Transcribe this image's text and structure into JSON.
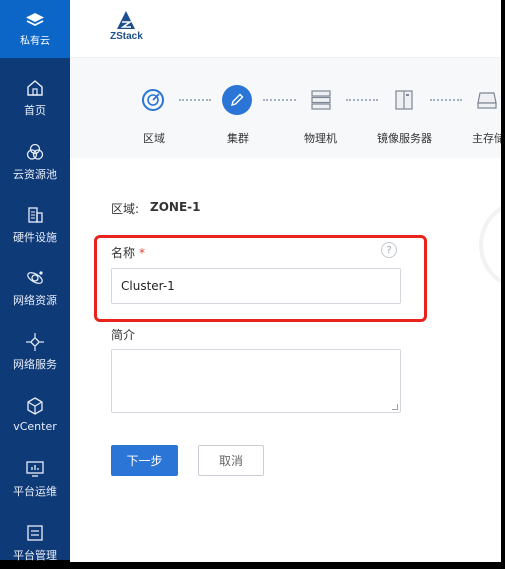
{
  "sidebar": {
    "top": {
      "label": "私有云",
      "icon": "layers-icon"
    },
    "items": [
      {
        "label": "首页",
        "icon": "home-icon"
      },
      {
        "label": "云资源池",
        "icon": "circles-icon"
      },
      {
        "label": "硬件设施",
        "icon": "building-icon"
      },
      {
        "label": "网络资源",
        "icon": "network-icon"
      },
      {
        "label": "网络服务",
        "icon": "hub-icon"
      },
      {
        "label": "vCenter",
        "icon": "cube-icon"
      },
      {
        "label": "平台运维",
        "icon": "monitor-icon"
      },
      {
        "label": "平台管理",
        "icon": "panel-icon"
      }
    ]
  },
  "header": {
    "logo_text": "ZStack"
  },
  "steps": [
    {
      "label": "区域",
      "icon": "zone-icon",
      "state": "done"
    },
    {
      "label": "集群",
      "icon": "pencil-icon",
      "state": "active"
    },
    {
      "label": "物理机",
      "icon": "server-icon",
      "state": "pending"
    },
    {
      "label": "镜像服务器",
      "icon": "image-server-icon",
      "state": "pending"
    },
    {
      "label": "主存储",
      "icon": "storage-icon",
      "state": "pending"
    }
  ],
  "form": {
    "zone_label": "区域:",
    "zone_value": "ZONE-1",
    "name_label": "名称",
    "required_mark": "*",
    "help_text": "?",
    "name_value": "Cluster-1",
    "description_label": "简介",
    "description_value": ""
  },
  "buttons": {
    "next": "下一步",
    "cancel": "取消"
  },
  "colors": {
    "sidebar": "#0f3a78",
    "sidebar_active": "#0c66c8",
    "accent": "#2a75d6",
    "highlight": "#e8231c"
  }
}
